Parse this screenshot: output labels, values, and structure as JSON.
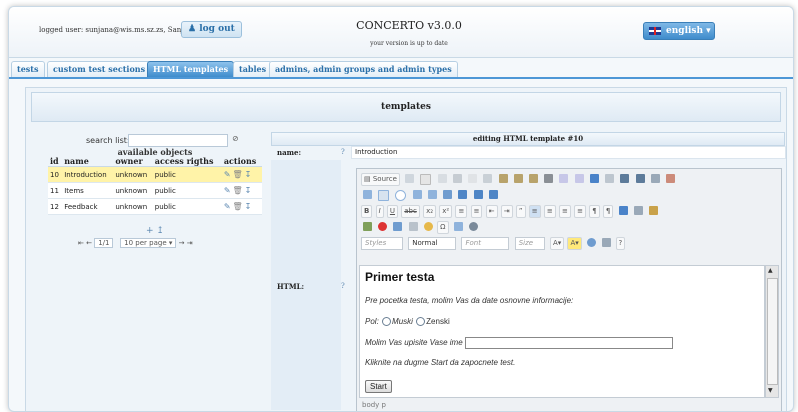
{
  "header": {
    "logged_user": "logged user: sunjana@wis.ms.sz.zs, Sanja Clear",
    "logout_label": "log out",
    "app_title": "CONCERTO v3.0.0",
    "version_status": "your version is up to date",
    "language": "english"
  },
  "tabs": [
    {
      "label": "tests"
    },
    {
      "label": "custom test sections"
    },
    {
      "label": "HTML templates"
    },
    {
      "label": "tables"
    },
    {
      "label": "admins, admin groups and admin types"
    }
  ],
  "main": {
    "section_title": "templates"
  },
  "list": {
    "search_label": "search list:",
    "title": "available objects",
    "columns": [
      "id",
      "name",
      "owner",
      "access rigths",
      "actions"
    ],
    "rows": [
      {
        "id": "10",
        "name": "Introduction",
        "owner": "unknown",
        "access": "public",
        "selected": true
      },
      {
        "id": "11",
        "name": "Items",
        "owner": "unknown",
        "access": "public",
        "selected": false
      },
      {
        "id": "12",
        "name": "Feedback",
        "owner": "unknown",
        "access": "public",
        "selected": false
      }
    ],
    "page": "1/1",
    "per_page": "10 per page"
  },
  "form": {
    "editing_title": "editing HTML template #10",
    "name_label": "name:",
    "name_value": "Introduction",
    "html_label": "HTML:",
    "help_mark": "?",
    "editor": {
      "source_label": "Source",
      "styles_placeholder": "Styles",
      "format_value": "Normal",
      "font_placeholder": "Font",
      "size_placeholder": "Size",
      "status_path": "body p"
    },
    "content": {
      "heading": "Primer testa",
      "intro": "Pre pocetka testa, molim Vas da date osnovne informacije:",
      "gender_label": "Pol:",
      "option_male": "Muski",
      "option_female": "Zenski",
      "name_prompt": "Molim Vas upisite Vase ime",
      "instruction": "Kliknite na dugme Start da zapocnete test.",
      "start_button": "Start"
    }
  }
}
